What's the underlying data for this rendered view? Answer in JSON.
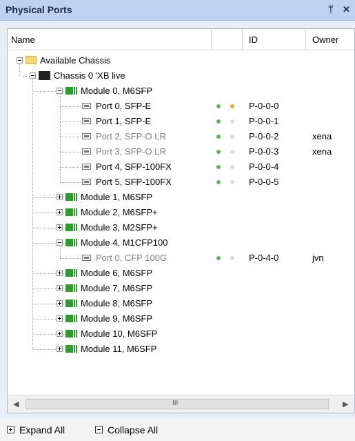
{
  "panel": {
    "title": "Physical Ports",
    "pin_icon": "pin-icon",
    "close_icon": "close-icon",
    "pin_glyph": "ᛘ",
    "close_glyph": "✕"
  },
  "columns": {
    "name": "Name",
    "id": "ID",
    "owner": "Owner"
  },
  "tree": {
    "root": {
      "label": "Available Chassis",
      "icon": "folder-icon"
    },
    "chassis": {
      "label": "Chassis 0 'XB live",
      "icon": "chassis-icon"
    },
    "modules": [
      {
        "label": "Module 0, M6SFP",
        "expanded": true,
        "ports": [
          {
            "label": "Port 0, SFP-E",
            "id": "P-0-0-0",
            "owner": "",
            "link": "green",
            "activity": "orange",
            "dim": false
          },
          {
            "label": "Port 1, SFP-E",
            "id": "P-0-0-1",
            "owner": "",
            "link": "green",
            "activity": "off",
            "dim": false
          },
          {
            "label": "Port 2, SFP-O LR",
            "id": "P-0-0-2",
            "owner": "xena",
            "link": "green",
            "activity": "off",
            "dim": true
          },
          {
            "label": "Port 3, SFP-O LR",
            "id": "P-0-0-3",
            "owner": "xena",
            "link": "green",
            "activity": "off",
            "dim": true
          },
          {
            "label": "Port 4, SFP-100FX",
            "id": "P-0-0-4",
            "owner": "",
            "link": "green",
            "activity": "off",
            "dim": false
          },
          {
            "label": "Port 5, SFP-100FX",
            "id": "P-0-0-5",
            "owner": "",
            "link": "green",
            "activity": "off",
            "dim": false
          }
        ]
      },
      {
        "label": "Module 1, M6SFP",
        "expanded": false,
        "ports": []
      },
      {
        "label": "Module 2, M6SFP+",
        "expanded": false,
        "ports": []
      },
      {
        "label": "Module 3, M2SFP+",
        "expanded": false,
        "ports": []
      },
      {
        "label": "Module 4, M1CFP100",
        "expanded": true,
        "ports": [
          {
            "label": "Port 0, CFP 100G",
            "id": "P-0-4-0",
            "owner": "jvn",
            "link": "green",
            "activity": "off",
            "dim": true
          }
        ]
      },
      {
        "label": "Module 6, M6SFP",
        "expanded": false,
        "ports": []
      },
      {
        "label": "Module 7, M6SFP",
        "expanded": false,
        "ports": []
      },
      {
        "label": "Module 8, M6SFP",
        "expanded": false,
        "ports": []
      },
      {
        "label": "Module 9, M6SFP",
        "expanded": false,
        "ports": []
      },
      {
        "label": "Module 10, M6SFP",
        "expanded": false,
        "ports": []
      },
      {
        "label": "Module 11, M6SFP",
        "expanded": false,
        "ports": []
      }
    ]
  },
  "scrollbar": {
    "left_glyph": "◀",
    "right_glyph": "▶",
    "grip_glyph": "III"
  },
  "footer": {
    "expand_all": "Expand All",
    "collapse_all": "Collapse All"
  },
  "colors": {
    "led_green": "#5cb85c",
    "led_orange": "#f0a830",
    "led_off": "#dcdcdc"
  }
}
